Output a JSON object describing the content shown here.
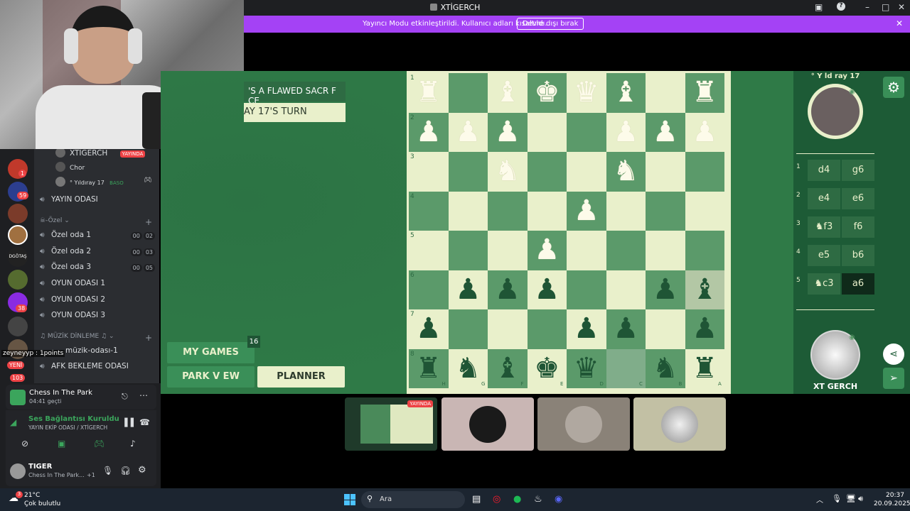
{
  "window": {
    "title": "XTİGERCH"
  },
  "banner": {
    "text": "Yayıncı Modu etkinleştirildi. Kullanıcı adları kısaltıldı.",
    "button": "Devre dışı bırak"
  },
  "sidebar": {
    "users": [
      "XTİGERCH",
      "Chor",
      "° Yıldıray 17"
    ],
    "live_badge": "YAYINDA",
    "baso": "BASO",
    "channels": [
      {
        "name": "YAYIN ODASI"
      },
      {
        "name": "Özel oda 1",
        "a": "00",
        "b": "02"
      },
      {
        "name": "Özel oda 2",
        "a": "00",
        "b": "03"
      },
      {
        "name": "Özel oda 3",
        "a": "00",
        "b": "05"
      },
      {
        "name": "OYUN ODASI 1"
      },
      {
        "name": "OYUN ODASI 2"
      },
      {
        "name": "OYUN ODASI 3"
      },
      {
        "name": "müzik-odası-1"
      },
      {
        "name": "AFK BEKLEME ODASI"
      }
    ],
    "category_ozel": "-Özel",
    "category_muzik": "♫ MÜZİK DİNLEME ♫",
    "overlay_user": "zeyneyyp : 1points",
    "new_badge": "YENİ",
    "badges": [
      "1",
      "59",
      "38",
      "103"
    ],
    "server_text": "DGÖTAŞ"
  },
  "activity": {
    "title": "Chess In The Park",
    "time": "04:41 geçti"
  },
  "voice": {
    "status": "Ses Bağlantısı Kuruldu",
    "channel": "YAYIN EKİP ODASI / XTİGERCH"
  },
  "user": {
    "name": "TIGER",
    "status": "Chess In The Park...",
    "plus": "+1"
  },
  "game": {
    "banner_top": "'S A FLAWED SACR F CE",
    "banner_turn": "AY 17'S TURN",
    "my_games": "MY GAMES",
    "games_count": "16",
    "park_view": "PARK V EW",
    "planner": "PLANNER"
  },
  "board": {
    "ranks": [
      "1",
      "2",
      "3",
      "4",
      "5",
      "6",
      "7",
      "8"
    ],
    "files": [
      "H",
      "G",
      "F",
      "E",
      "D",
      "C",
      "B",
      "A"
    ],
    "pieces": [
      {
        "r": 0,
        "c": 0,
        "p": "♜",
        "w": true
      },
      {
        "r": 0,
        "c": 2,
        "p": "♝",
        "w": true
      },
      {
        "r": 0,
        "c": 3,
        "p": "♚",
        "w": true
      },
      {
        "r": 0,
        "c": 4,
        "p": "♛",
        "w": true
      },
      {
        "r": 0,
        "c": 5,
        "p": "♝",
        "w": true
      },
      {
        "r": 0,
        "c": 7,
        "p": "♜",
        "w": true
      },
      {
        "r": 1,
        "c": 0,
        "p": "♟",
        "w": true
      },
      {
        "r": 1,
        "c": 1,
        "p": "♟",
        "w": true
      },
      {
        "r": 1,
        "c": 2,
        "p": "♟",
        "w": true
      },
      {
        "r": 1,
        "c": 5,
        "p": "♟",
        "w": true
      },
      {
        "r": 1,
        "c": 6,
        "p": "♟",
        "w": true
      },
      {
        "r": 1,
        "c": 7,
        "p": "♟",
        "w": true
      },
      {
        "r": 2,
        "c": 2,
        "p": "♞",
        "w": true
      },
      {
        "r": 2,
        "c": 5,
        "p": "♞",
        "w": true
      },
      {
        "r": 3,
        "c": 4,
        "p": "♟",
        "w": true
      },
      {
        "r": 4,
        "c": 3,
        "p": "♟",
        "w": true
      },
      {
        "r": 5,
        "c": 1,
        "p": "♟",
        "w": false
      },
      {
        "r": 5,
        "c": 2,
        "p": "♟",
        "w": false
      },
      {
        "r": 5,
        "c": 3,
        "p": "♟",
        "w": false
      },
      {
        "r": 5,
        "c": 6,
        "p": "♟",
        "w": false
      },
      {
        "r": 5,
        "c": 7,
        "p": "♝",
        "w": false
      },
      {
        "r": 6,
        "c": 0,
        "p": "♟",
        "w": false
      },
      {
        "r": 6,
        "c": 4,
        "p": "♟",
        "w": false
      },
      {
        "r": 6,
        "c": 5,
        "p": "♟",
        "w": false
      },
      {
        "r": 6,
        "c": 7,
        "p": "♟",
        "w": false
      },
      {
        "r": 7,
        "c": 0,
        "p": "♜",
        "w": false
      },
      {
        "r": 7,
        "c": 1,
        "p": "♞",
        "w": false
      },
      {
        "r": 7,
        "c": 2,
        "p": "♝",
        "w": false
      },
      {
        "r": 7,
        "c": 3,
        "p": "♚",
        "w": false
      },
      {
        "r": 7,
        "c": 4,
        "p": "♛",
        "w": false
      },
      {
        "r": 7,
        "c": 6,
        "p": "♞",
        "w": false
      },
      {
        "r": 7,
        "c": 7,
        "p": "♜",
        "w": false
      }
    ]
  },
  "moves_panel": {
    "player_top": "° Y ld ray 17",
    "player_bottom": "XT GERCH",
    "moves": [
      {
        "n": "1",
        "w": "d4",
        "b": "g6"
      },
      {
        "n": "2",
        "w": "e4",
        "b": "e6"
      },
      {
        "n": "3",
        "w": "♞f3",
        "b": "f6"
      },
      {
        "n": "4",
        "w": "e5",
        "b": "b6"
      },
      {
        "n": "5",
        "w": "♞c3",
        "b": "a6"
      }
    ]
  },
  "thumbs": {
    "live": "YAYINDA"
  },
  "taskbar": {
    "temp": "21°C",
    "weather": "Çok bulutlu",
    "weather_badge": "3",
    "search": "Ara",
    "time": "20:37",
    "date": "20.09.2025"
  },
  "colors": {
    "light": "#e9f0cb",
    "dark": "#5b9a6a",
    "accent": "#a442f5"
  }
}
